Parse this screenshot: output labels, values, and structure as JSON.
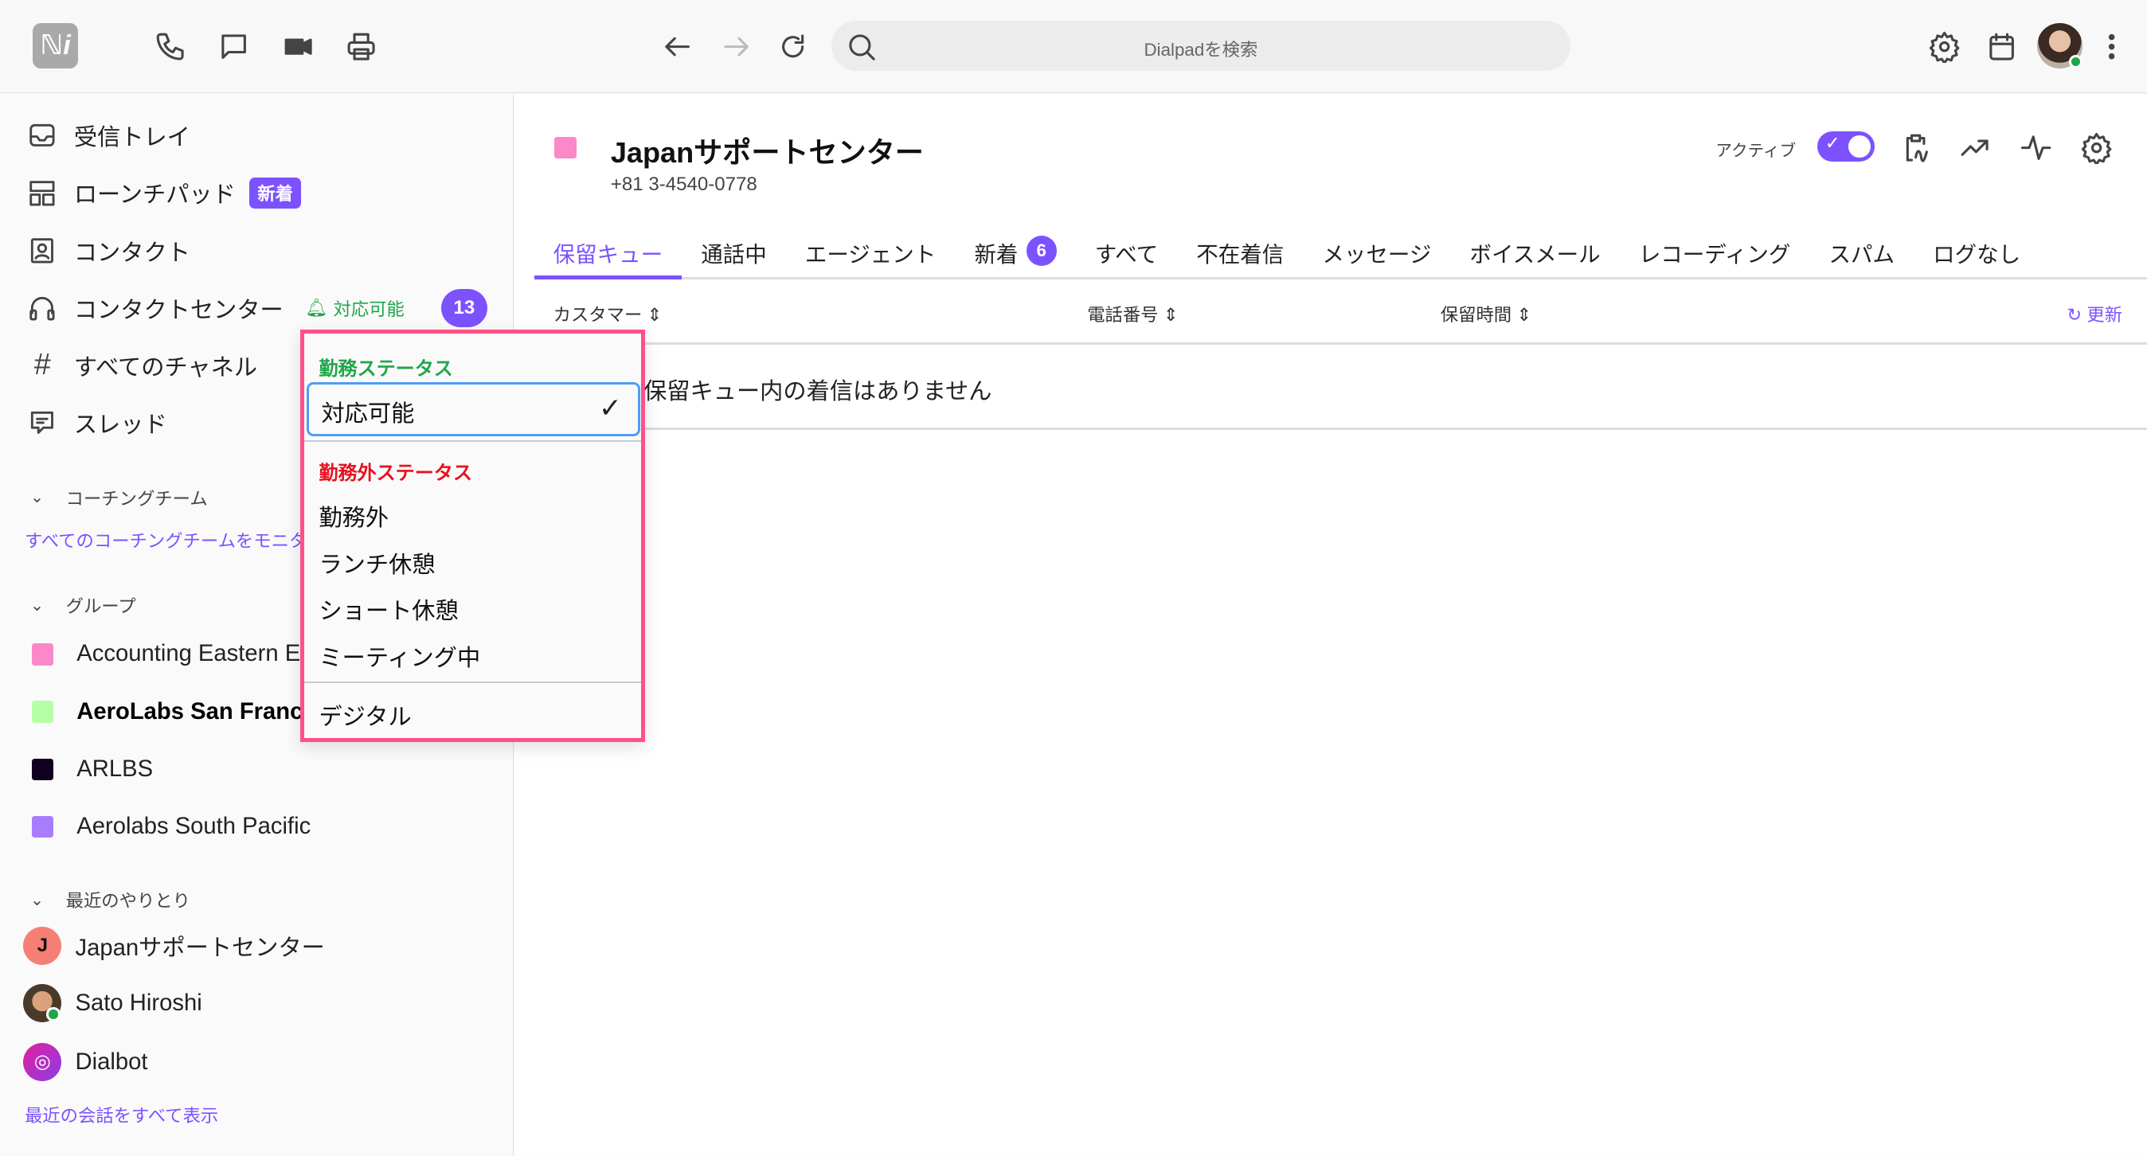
{
  "topbar": {
    "logo": "ℕi",
    "search_placeholder": "Dialpadを検索",
    "icons": [
      "phone-icon",
      "chat-icon",
      "video-icon",
      "print-icon",
      "back-icon",
      "forward-icon",
      "refresh-icon",
      "search-icon",
      "gear-icon",
      "calendar-icon",
      "more-icon"
    ]
  },
  "sidebar": {
    "items": [
      {
        "label": "受信トレイ"
      },
      {
        "label": "ローンチパッド",
        "badge": "新着"
      },
      {
        "label": "コンタクト"
      },
      {
        "label": "コンタクトセンター",
        "status": "対応可能",
        "count": "13"
      },
      {
        "label": "すべてのチャネル"
      },
      {
        "label": "スレッド"
      }
    ],
    "coaching": {
      "title": "コーチングチーム",
      "link": "すべてのコーチングチームをモニター"
    },
    "groups": {
      "title": "グループ",
      "items": [
        {
          "label": "Accounting Eastern Europe",
          "color": "#fb88c8"
        },
        {
          "label": "AeroLabs San Francisco",
          "color": "#b6ffa8"
        },
        {
          "label": "ARLBS",
          "color": "#120020"
        },
        {
          "label": "Aerolabs South Pacific",
          "color": "#a97cff"
        }
      ]
    },
    "recent": {
      "title": "最近のやりとり",
      "items": [
        {
          "label": "Japanサポートセンター",
          "initial": "J"
        },
        {
          "label": "Sato Hiroshi"
        },
        {
          "label": "Dialbot"
        }
      ],
      "link": "最近の会話をすべて表示"
    }
  },
  "main": {
    "title": "Japanサポートセンター",
    "phone": "+81 3-4540-0778",
    "color": "#fb88c8",
    "active_label": "アクティブ",
    "active": true,
    "tabs": [
      {
        "label": "保留キュー",
        "active": true
      },
      {
        "label": "通話中"
      },
      {
        "label": "エージェント"
      },
      {
        "label": "新着",
        "count": "6"
      },
      {
        "label": "すべて"
      },
      {
        "label": "不在着信"
      },
      {
        "label": "メッセージ"
      },
      {
        "label": "ボイスメール"
      },
      {
        "label": "レコーディング"
      },
      {
        "label": "スパム"
      },
      {
        "label": "ログなし"
      }
    ],
    "columns": [
      "カスタマー",
      "電話番号",
      "保留時間"
    ],
    "refresh": "更新",
    "empty": "保留キュー内の着信はありません"
  },
  "status_menu": {
    "on_duty_header": "勤務ステータス",
    "selected": "対応可能",
    "off_duty_header": "勤務外ステータス",
    "off_items": [
      "勤務外",
      "ランチ休憩",
      "ショート休憩",
      "ミーティング中"
    ],
    "digital": "デジタル"
  },
  "colors": {
    "accent": "#7c52ff",
    "on_duty": "#1fa64a",
    "off_duty": "#e8101e",
    "highlight": "#ff5088"
  }
}
